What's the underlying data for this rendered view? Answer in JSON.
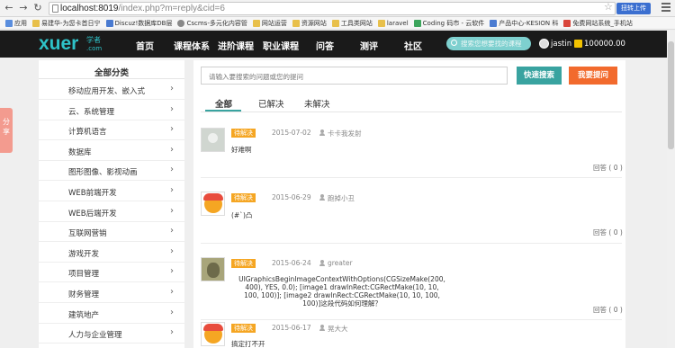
{
  "browser": {
    "url_host": "localhost:8019",
    "url_path": "/index.php?m=reply&cid=6",
    "ext_button": "扭转上传",
    "bookmarks": [
      "应用",
      "易建华-为您卡首日宁",
      "Discuz!数据库DB层",
      "Cscms-多元化内容管",
      "网站运营",
      "资源网站",
      "工具类网站",
      "laravel",
      "Coding 码市 - 云软件",
      "产品中心-KESION 科",
      "免费网站系统_手机站"
    ]
  },
  "header": {
    "logo": "xuer",
    "logo_sub": "学者",
    "logo_sub2": ".com",
    "nav": [
      "首页",
      "课程体系",
      "进阶课程",
      "职业课程",
      "问答",
      "测评",
      "社区"
    ],
    "search_placeholder": "搜索您想要找的课程",
    "username": "jastin",
    "coins": "100000.00"
  },
  "sidebar": {
    "title": "全部分类",
    "share": "分享",
    "items": [
      "移动应用开发、嵌入式",
      "云、系统管理",
      "计算机语言",
      "数据库",
      "图形图像、影视动画",
      "WEB前端开发",
      "WEB后端开发",
      "互联网营销",
      "游戏开发",
      "项目管理",
      "财务管理",
      "建筑地产",
      "人力与企业管理"
    ]
  },
  "main": {
    "question_placeholder": "请输入要搜索的问题或您的提问",
    "search_button": "快速搜索",
    "ask_button": "我要提问",
    "tabs": [
      "全部",
      "已解决",
      "未解决"
    ],
    "questions": [
      {
        "status": "待解决",
        "date": "2015-07-02",
        "user": "卡卡我发射",
        "title": "好难啊",
        "answers": "回答 ( 0 )"
      },
      {
        "status": "待解决",
        "date": "2015-06-29",
        "user": "跑掉小丑",
        "title": "(#`)凸",
        "answers": "回答 ( 0 )"
      },
      {
        "status": "待解决",
        "date": "2015-06-24",
        "user": "greater",
        "title": "UIGraphicsBeginImageContextWithOptions(CGSizeMake(200, 400), YES, 0.0); [image1 drawInRect:CGRectMake(10, 10, 100, 100)]; [image2 drawInRect:CGRectMake(10, 10, 100, 100)]这段代码如何理解？",
        "answers": "回答 ( 0 )"
      },
      {
        "status": "待解决",
        "date": "2015-06-17",
        "user": "晃大大",
        "title": "搞定打不开",
        "answers": ""
      }
    ]
  },
  "colors": {
    "accent": "#39a3a0",
    "ask": "#f26a2d",
    "status": "#f5a623",
    "header_bg": "#1a1a1a"
  }
}
